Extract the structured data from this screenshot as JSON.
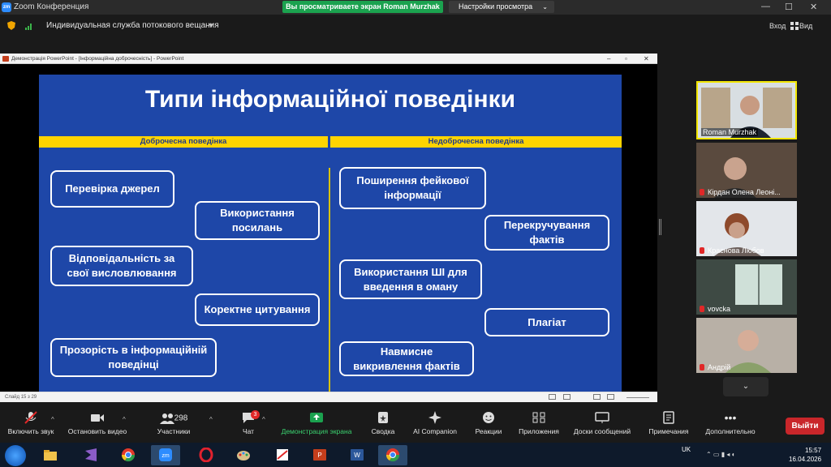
{
  "titlebar": {
    "app_logo": "zm",
    "title": "Zoom Конференция",
    "share_banner": "Вы просматриваете экран Roman Murzhak",
    "view_options": "Настройки просмотра",
    "minimize": "—",
    "maximize": "☐",
    "close": "✕"
  },
  "toolbar2": {
    "stream_label": "Индивидуальная служба потокового вещания",
    "enter": "Вход",
    "view": "Вид"
  },
  "ppt": {
    "window_title": "Демонстрація PowerPoint - [Інформаційна доброчесність] - PowerPoint",
    "status_left": "Слайд 15 з 29",
    "slide": {
      "title": "Типи інформаційної поведінки",
      "left_header": "Доброчесна поведінка",
      "right_header": "Недоброчесна поведінка",
      "boxes": [
        "Перевірка джерел",
        "Використання посилань",
        "Відповідальність за свої висловлювання",
        "Коректне цитування",
        "Прозорість в інформаційній поведінці",
        "Поширення фейкової інформації",
        "Перекручування фактів",
        "Використання ШІ для введення в оману",
        "Плагіат",
        "Навмисне викривлення фактів"
      ]
    }
  },
  "participants": [
    {
      "name": "Roman Murzhak"
    },
    {
      "name": "Кірдан Олена Леоні..."
    },
    {
      "name": "Краснова Любов"
    },
    {
      "name": "vovcka"
    },
    {
      "name": "Андрій"
    }
  ],
  "more_icon": "chevron-down",
  "bottombar": {
    "mute": "Включить звук",
    "video": "Остановить видео",
    "participants": "Участники",
    "participants_count": "298",
    "chat": "Чат",
    "chat_badge": "3",
    "share": "Демонстрация экрана",
    "summary": "Сводка",
    "ai": "AI Companion",
    "reactions": "Реакции",
    "apps": "Приложения",
    "whiteboards": "Доски сообщений",
    "notes": "Примечания",
    "more": "Дополнительно",
    "leave": "Выйти"
  },
  "taskbar": {
    "lang": "UK",
    "time": "15:57",
    "date": "16.04.2026"
  },
  "colors": {
    "slide_bg": "#1e47a8",
    "accent_yellow": "#ffd400",
    "share_green": "#1ba24f",
    "leave_red": "#c9262a"
  }
}
